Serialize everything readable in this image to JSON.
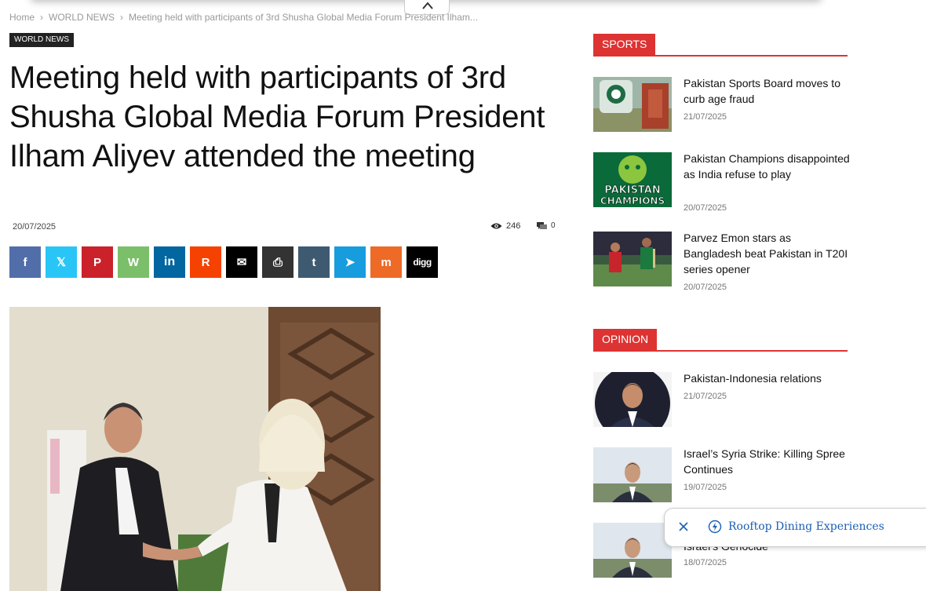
{
  "breadcrumb": {
    "home": "Home",
    "category": "WORLD NEWS",
    "current": "Meeting held with participants of 3rd Shusha Global Media Forum President Ilham..."
  },
  "article": {
    "category_tag": "WORLD NEWS",
    "title": "Meeting held with participants of 3rd Shusha Global Media Forum President Ilham Aliyev attended the meeting",
    "date": "20/07/2025",
    "views": "246",
    "comments": "0"
  },
  "share_buttons": [
    {
      "name": "facebook",
      "glyph": "f",
      "color": "#516eab"
    },
    {
      "name": "x",
      "glyph": "𝕏",
      "color": "#29c5f6"
    },
    {
      "name": "pinterest",
      "glyph": "P",
      "color": "#ca212a"
    },
    {
      "name": "whatsapp",
      "glyph": "W",
      "color": "#7bbf6a"
    },
    {
      "name": "linkedin",
      "glyph": "in",
      "color": "#0266a0"
    },
    {
      "name": "reddit",
      "glyph": "R",
      "color": "#f54200"
    },
    {
      "name": "email",
      "glyph": "✉",
      "color": "#000000"
    },
    {
      "name": "print",
      "glyph": "⎙",
      "color": "#333333"
    },
    {
      "name": "tumblr",
      "glyph": "t",
      "color": "#3e5a70"
    },
    {
      "name": "telegram",
      "glyph": "➤",
      "color": "#179cde"
    },
    {
      "name": "mix",
      "glyph": "m",
      "color": "#ed6a27"
    },
    {
      "name": "digg",
      "glyph": "digg",
      "color": "#000000"
    }
  ],
  "sidebar": {
    "sports": {
      "label": "SPORTS",
      "items": [
        {
          "title": "Pakistan Sports Board moves to curb age fraud",
          "date": "21/07/2025"
        },
        {
          "title": "Pakistan Champions disappointed as India refuse to play",
          "date": "20/07/2025"
        },
        {
          "title": "Parvez Emon stars as Bangladesh beat Pakistan in T20I series opener",
          "date": "20/07/2025"
        }
      ]
    },
    "opinion": {
      "label": "OPINION",
      "items": [
        {
          "title": "Pakistan-Indonesia relations",
          "date": "21/07/2025"
        },
        {
          "title": "Israel’s Syria Strike: Killing Spree Continues",
          "date": "19/07/2025"
        },
        {
          "title": "Israel’s Genocide",
          "date": "18/07/2025"
        }
      ]
    }
  },
  "thumb_text": {
    "champions_line1": "PAKISTAN",
    "champions_line2": "CHAMPIONS"
  },
  "popup": {
    "text": "Rooftop Dining Experiences"
  },
  "colors": {
    "accent_red": "#dd3333",
    "link_blue": "#1a5fb4"
  }
}
